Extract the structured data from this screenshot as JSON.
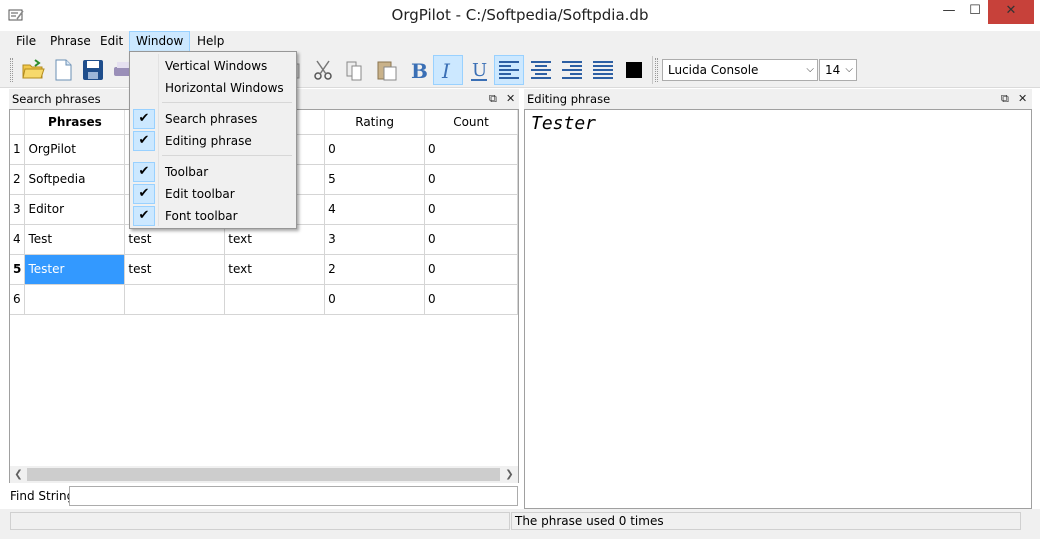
{
  "window": {
    "title": "OrgPilot - C:/Softpedia/Softpdia.db",
    "minimize": "—",
    "maximize": "☐",
    "close": "✕"
  },
  "menubar": {
    "items": [
      "File",
      "Phrase",
      "Edit",
      "Window",
      "Help"
    ]
  },
  "window_menu": {
    "items": [
      {
        "label": "Vertical Windows",
        "checked": false
      },
      {
        "label": "Horizontal Windows",
        "checked": false
      },
      {
        "label": "Search phrases",
        "checked": true
      },
      {
        "label": "Editing phrase",
        "checked": true
      },
      {
        "label": "Toolbar",
        "checked": true
      },
      {
        "label": "Edit toolbar",
        "checked": true
      },
      {
        "label": "Font toolbar",
        "checked": true
      }
    ]
  },
  "toolbar": {
    "font_name": "Lucida Console",
    "font_size": "14",
    "text_color": "#000000"
  },
  "search_panel": {
    "title": "Search phrases",
    "columns": [
      "Phrases",
      "",
      "",
      "Rating",
      "Count"
    ],
    "rows": [
      {
        "num": "1",
        "phrase": "OrgPilot",
        "a": "",
        "b": "",
        "rating": "0",
        "count": "0"
      },
      {
        "num": "2",
        "phrase": "Softpedia",
        "a": "",
        "b": "",
        "rating": "5",
        "count": "0"
      },
      {
        "num": "3",
        "phrase": "Editor",
        "a": "",
        "b": "",
        "rating": "4",
        "count": "0"
      },
      {
        "num": "4",
        "phrase": "Test",
        "a": "test",
        "b": "text",
        "rating": "3",
        "count": "0"
      },
      {
        "num": "5",
        "phrase": "Tester",
        "a": "test",
        "b": "text",
        "rating": "2",
        "count": "0"
      },
      {
        "num": "6",
        "phrase": "",
        "a": "",
        "b": "",
        "rating": "0",
        "count": "0"
      }
    ],
    "find_label": "Find Strings",
    "find_value": ""
  },
  "editing_panel": {
    "title": "Editing phrase",
    "content": "Tester"
  },
  "statusbar": {
    "text": "The phrase used 0 times"
  },
  "colors": {
    "selection": "#3399ff",
    "menu_highlight": "#cce8ff",
    "close_button": "#c7413a"
  }
}
